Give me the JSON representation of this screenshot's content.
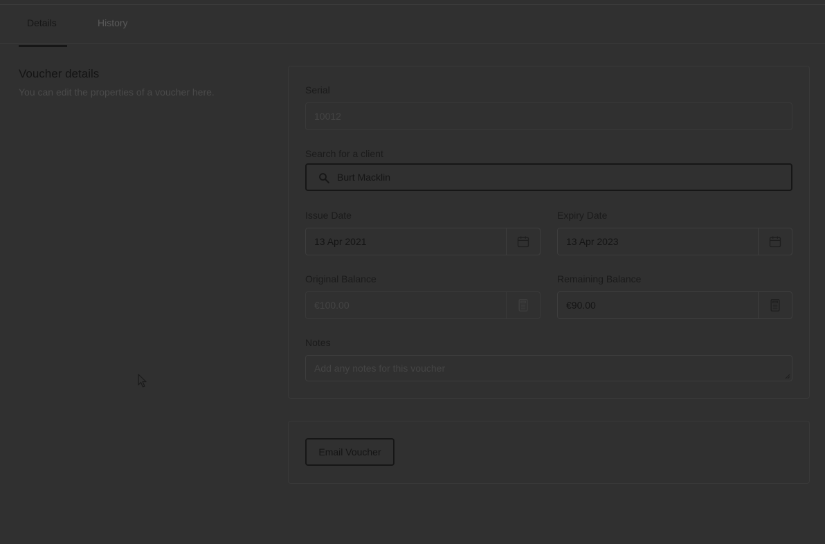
{
  "tabs": [
    {
      "label": "Details",
      "active": true
    },
    {
      "label": "History",
      "active": false
    }
  ],
  "section": {
    "title": "Voucher details",
    "description": "You can edit the properties of a voucher here."
  },
  "form": {
    "serial": {
      "label": "Serial",
      "value": "10012"
    },
    "client": {
      "label": "Search for a client",
      "value": "Burt Macklin"
    },
    "issue_date": {
      "label": "Issue Date",
      "value": "13 Apr 2021"
    },
    "expiry_date": {
      "label": "Expiry Date",
      "value": "13 Apr 2023"
    },
    "original_balance": {
      "label": "Original Balance",
      "value": "€100.00"
    },
    "remaining_balance": {
      "label": "Remaining Balance",
      "value": "€90.00"
    },
    "notes": {
      "label": "Notes",
      "placeholder": "Add any notes for this voucher"
    }
  },
  "actions": {
    "email_label": "Email Voucher"
  },
  "icons": {
    "search": "search-icon",
    "calendar": "calendar-icon",
    "calculator": "calculator-icon",
    "cursor": "mouse-cursor-icon"
  },
  "colors": {
    "overlay_bg": "#303030",
    "text_primary": "#141414",
    "border": "#3d3d3d"
  }
}
